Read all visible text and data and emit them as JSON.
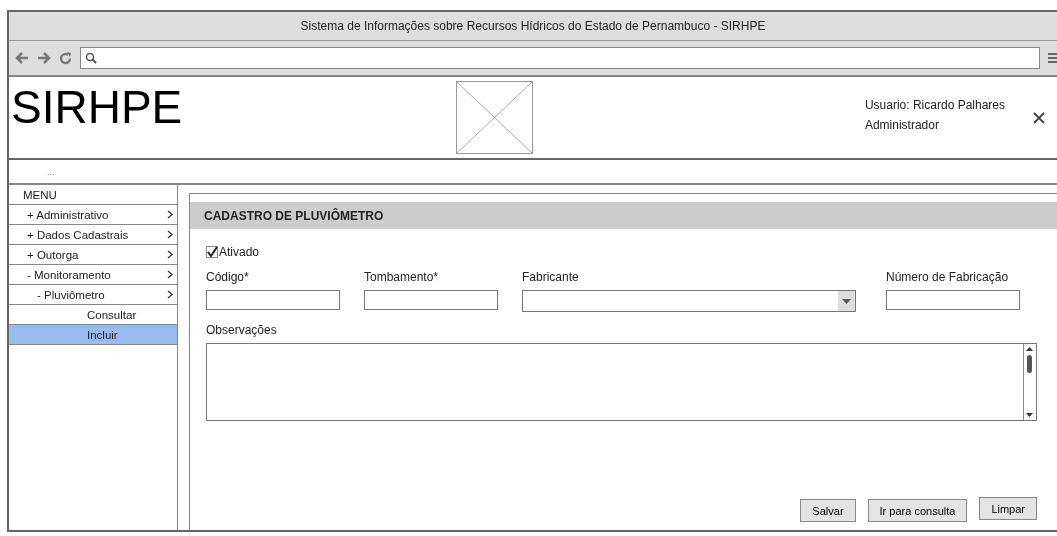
{
  "window": {
    "title": "Sistema de Informações sobre Recursos Hídricos do Estado de Pernambuco - SIRHPE"
  },
  "header": {
    "logo": "SIRHPE",
    "user": "Usuario: Ricardo Palhares",
    "role": "Administrador"
  },
  "breadcrumb": "...",
  "sidebar": {
    "title": "MENU",
    "items": [
      {
        "label": "+ Administrativo",
        "has_arrow": true,
        "selected": false
      },
      {
        "label": "+ Dados Cadastrais",
        "has_arrow": true,
        "selected": false
      },
      {
        "label": "+ Outorga",
        "has_arrow": true,
        "selected": false
      },
      {
        "label": "- Monitoramento",
        "has_arrow": true,
        "selected": false,
        "children": [
          {
            "label": "- Pluviômetro",
            "has_arrow": true,
            "selected": false,
            "children": [
              {
                "label": "Consultar",
                "has_arrow": false,
                "selected": false
              },
              {
                "label": "Incluir",
                "has_arrow": false,
                "selected": true
              }
            ]
          }
        ]
      }
    ]
  },
  "form": {
    "title": "CADASTRO DE PLUVIÔMETRO",
    "active": {
      "label": "Ativado",
      "checked": true
    },
    "fields": [
      {
        "label": "Código*",
        "kind": "text"
      },
      {
        "label": "Tombamento*",
        "kind": "text"
      },
      {
        "label": "Fabricante",
        "kind": "select"
      },
      {
        "label": "Número de Fabricação",
        "kind": "text"
      }
    ],
    "notes": {
      "label": "Observações"
    },
    "buttons": [
      "Salvar",
      "Ir para consulta",
      "Limpar"
    ]
  }
}
